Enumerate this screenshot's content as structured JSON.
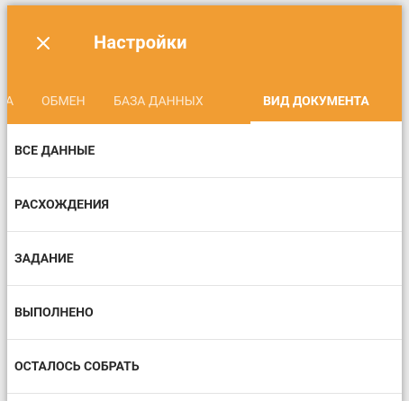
{
  "appbar": {
    "title": "Настройки",
    "close_icon": "close-icon",
    "color": "#f19d33"
  },
  "tabs": [
    {
      "label": "А"
    },
    {
      "label": "ОБМЕН"
    },
    {
      "label": "БАЗА ДАННЫХ"
    },
    {
      "label": "ВИД ДОКУМЕНТА",
      "active": true
    }
  ],
  "list": {
    "items": [
      {
        "label": "ВСЕ ДАННЫЕ"
      },
      {
        "label": "РАСХОЖДЕНИЯ"
      },
      {
        "label": "ЗАДАНИЕ"
      },
      {
        "label": "ВЫПОЛНЕНО"
      },
      {
        "label": "ОСТАЛОСЬ СОБРАТЬ"
      }
    ]
  }
}
